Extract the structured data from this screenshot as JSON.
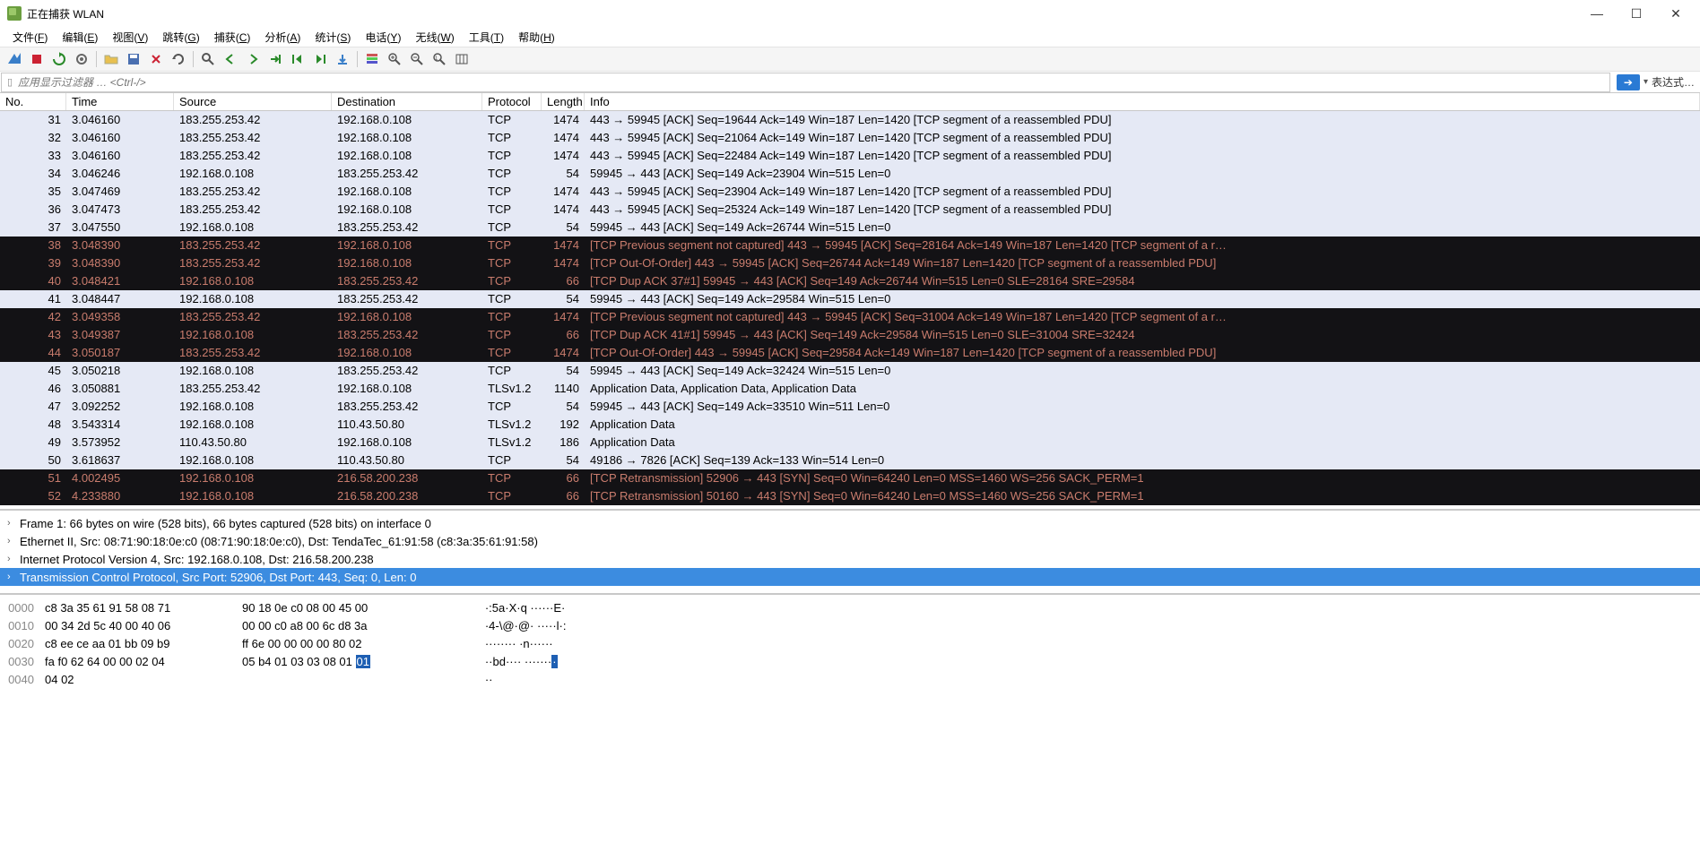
{
  "window": {
    "title": "正在捕获 WLAN"
  },
  "menu": {
    "items": [
      {
        "l": "文件",
        "u": "F"
      },
      {
        "l": "编辑",
        "u": "E"
      },
      {
        "l": "视图",
        "u": "V"
      },
      {
        "l": "跳转",
        "u": "G"
      },
      {
        "l": "捕获",
        "u": "C"
      },
      {
        "l": "分析",
        "u": "A"
      },
      {
        "l": "统计",
        "u": "S"
      },
      {
        "l": "电话",
        "u": "Y"
      },
      {
        "l": "无线",
        "u": "W"
      },
      {
        "l": "工具",
        "u": "T"
      },
      {
        "l": "帮助",
        "u": "H"
      }
    ]
  },
  "filter": {
    "placeholder": "应用显示过滤器 … <Ctrl-/>"
  },
  "expr": {
    "label": "表达式…"
  },
  "columns": {
    "no": "No.",
    "time": "Time",
    "source": "Source",
    "dest": "Destination",
    "proto": "Protocol",
    "len": "Length",
    "info": "Info"
  },
  "packets": [
    {
      "style": "light",
      "no": "31",
      "time": "3.046160",
      "src": "183.255.253.42",
      "dst": "192.168.0.108",
      "proto": "TCP",
      "len": "1474",
      "info": "443 → 59945 [ACK] Seq=19644 Ack=149 Win=187 Len=1420 [TCP segment of a reassembled PDU]"
    },
    {
      "style": "light",
      "no": "32",
      "time": "3.046160",
      "src": "183.255.253.42",
      "dst": "192.168.0.108",
      "proto": "TCP",
      "len": "1474",
      "info": "443 → 59945 [ACK] Seq=21064 Ack=149 Win=187 Len=1420 [TCP segment of a reassembled PDU]"
    },
    {
      "style": "light",
      "no": "33",
      "time": "3.046160",
      "src": "183.255.253.42",
      "dst": "192.168.0.108",
      "proto": "TCP",
      "len": "1474",
      "info": "443 → 59945 [ACK] Seq=22484 Ack=149 Win=187 Len=1420 [TCP segment of a reassembled PDU]"
    },
    {
      "style": "light",
      "no": "34",
      "time": "3.046246",
      "src": "192.168.0.108",
      "dst": "183.255.253.42",
      "proto": "TCP",
      "len": "54",
      "info": "59945 → 443 [ACK] Seq=149 Ack=23904 Win=515 Len=0"
    },
    {
      "style": "light",
      "no": "35",
      "time": "3.047469",
      "src": "183.255.253.42",
      "dst": "192.168.0.108",
      "proto": "TCP",
      "len": "1474",
      "info": "443 → 59945 [ACK] Seq=23904 Ack=149 Win=187 Len=1420 [TCP segment of a reassembled PDU]"
    },
    {
      "style": "light",
      "no": "36",
      "time": "3.047473",
      "src": "183.255.253.42",
      "dst": "192.168.0.108",
      "proto": "TCP",
      "len": "1474",
      "info": "443 → 59945 [ACK] Seq=25324 Ack=149 Win=187 Len=1420 [TCP segment of a reassembled PDU]"
    },
    {
      "style": "light",
      "no": "37",
      "time": "3.047550",
      "src": "192.168.0.108",
      "dst": "183.255.253.42",
      "proto": "TCP",
      "len": "54",
      "info": "59945 → 443 [ACK] Seq=149 Ack=26744 Win=515 Len=0"
    },
    {
      "style": "dark",
      "no": "38",
      "time": "3.048390",
      "src": "183.255.253.42",
      "dst": "192.168.0.108",
      "proto": "TCP",
      "len": "1474",
      "info": "[TCP Previous segment not captured] 443 → 59945 [ACK] Seq=28164 Ack=149 Win=187 Len=1420 [TCP segment of a r…"
    },
    {
      "style": "dark",
      "no": "39",
      "time": "3.048390",
      "src": "183.255.253.42",
      "dst": "192.168.0.108",
      "proto": "TCP",
      "len": "1474",
      "info": "[TCP Out-Of-Order] 443 → 59945 [ACK] Seq=26744 Ack=149 Win=187 Len=1420 [TCP segment of a reassembled PDU]"
    },
    {
      "style": "dark",
      "no": "40",
      "time": "3.048421",
      "src": "192.168.0.108",
      "dst": "183.255.253.42",
      "proto": "TCP",
      "len": "66",
      "info": "[TCP Dup ACK 37#1] 59945 → 443 [ACK] Seq=149 Ack=26744 Win=515 Len=0 SLE=28164 SRE=29584"
    },
    {
      "style": "light",
      "no": "41",
      "time": "3.048447",
      "src": "192.168.0.108",
      "dst": "183.255.253.42",
      "proto": "TCP",
      "len": "54",
      "info": "59945 → 443 [ACK] Seq=149 Ack=29584 Win=515 Len=0"
    },
    {
      "style": "dark",
      "no": "42",
      "time": "3.049358",
      "src": "183.255.253.42",
      "dst": "192.168.0.108",
      "proto": "TCP",
      "len": "1474",
      "info": "[TCP Previous segment not captured] 443 → 59945 [ACK] Seq=31004 Ack=149 Win=187 Len=1420 [TCP segment of a r…"
    },
    {
      "style": "dark",
      "no": "43",
      "time": "3.049387",
      "src": "192.168.0.108",
      "dst": "183.255.253.42",
      "proto": "TCP",
      "len": "66",
      "info": "[TCP Dup ACK 41#1] 59945 → 443 [ACK] Seq=149 Ack=29584 Win=515 Len=0 SLE=31004 SRE=32424"
    },
    {
      "style": "dark",
      "no": "44",
      "time": "3.050187",
      "src": "183.255.253.42",
      "dst": "192.168.0.108",
      "proto": "TCP",
      "len": "1474",
      "info": "[TCP Out-Of-Order] 443 → 59945 [ACK] Seq=29584 Ack=149 Win=187 Len=1420 [TCP segment of a reassembled PDU]"
    },
    {
      "style": "light",
      "no": "45",
      "time": "3.050218",
      "src": "192.168.0.108",
      "dst": "183.255.253.42",
      "proto": "TCP",
      "len": "54",
      "info": "59945 → 443 [ACK] Seq=149 Ack=32424 Win=515 Len=0"
    },
    {
      "style": "light",
      "no": "46",
      "time": "3.050881",
      "src": "183.255.253.42",
      "dst": "192.168.0.108",
      "proto": "TLSv1.2",
      "len": "1140",
      "info": "Application Data, Application Data, Application Data"
    },
    {
      "style": "light",
      "no": "47",
      "time": "3.092252",
      "src": "192.168.0.108",
      "dst": "183.255.253.42",
      "proto": "TCP",
      "len": "54",
      "info": "59945 → 443 [ACK] Seq=149 Ack=33510 Win=511 Len=0"
    },
    {
      "style": "light",
      "no": "48",
      "time": "3.543314",
      "src": "192.168.0.108",
      "dst": "110.43.50.80",
      "proto": "TLSv1.2",
      "len": "192",
      "info": "Application Data"
    },
    {
      "style": "light",
      "no": "49",
      "time": "3.573952",
      "src": "110.43.50.80",
      "dst": "192.168.0.108",
      "proto": "TLSv1.2",
      "len": "186",
      "info": "Application Data"
    },
    {
      "style": "light",
      "no": "50",
      "time": "3.618637",
      "src": "192.168.0.108",
      "dst": "110.43.50.80",
      "proto": "TCP",
      "len": "54",
      "info": "49186 → 7826 [ACK] Seq=139 Ack=133 Win=514 Len=0"
    },
    {
      "style": "dark",
      "no": "51",
      "time": "4.002495",
      "src": "192.168.0.108",
      "dst": "216.58.200.238",
      "proto": "TCP",
      "len": "66",
      "info": "[TCP Retransmission] 52906 → 443 [SYN] Seq=0 Win=64240 Len=0 MSS=1460 WS=256 SACK_PERM=1"
    },
    {
      "style": "dark",
      "no": "52",
      "time": "4.233880",
      "src": "192.168.0.108",
      "dst": "216.58.200.238",
      "proto": "TCP",
      "len": "66",
      "info": "[TCP Retransmission] 50160 → 443 [SYN] Seq=0 Win=64240 Len=0 MSS=1460 WS=256 SACK_PERM=1"
    }
  ],
  "details": [
    {
      "sel": false,
      "text": "Frame 1: 66 bytes on wire (528 bits), 66 bytes captured (528 bits) on interface 0"
    },
    {
      "sel": false,
      "text": "Ethernet II, Src: 08:71:90:18:0e:c0 (08:71:90:18:0e:c0), Dst: TendaTec_61:91:58 (c8:3a:35:61:91:58)"
    },
    {
      "sel": false,
      "text": "Internet Protocol Version 4, Src: 192.168.0.108, Dst: 216.58.200.238"
    },
    {
      "sel": true,
      "text": "Transmission Control Protocol, Src Port: 52906, Dst Port: 443, Seq: 0, Len: 0"
    }
  ],
  "hex": [
    {
      "off": "0000",
      "b1": "c8 3a 35 61 91 58 08 71",
      "b2": "90 18 0e c0 08 00 45 00",
      "asc": "   ·:5a·X·q ······E·"
    },
    {
      "off": "0010",
      "b1": "00 34 2d 5c 40 00 40 06",
      "b2": "00 00 c0 a8 00 6c d8 3a",
      "asc": "   ·4-\\@·@· ·····l·:"
    },
    {
      "off": "0020",
      "b1": "c8 ee ce aa 01 bb 09 b9",
      "b2": "ff 6e 00 00 00 00 80 02",
      "asc": "   ········ ·n······"
    },
    {
      "off": "0030",
      "b1": "fa f0 62 64 00 00 02 04",
      "b2": "05 b4 01 03 03 08 01 ",
      "asc": "   ··bd···· ·······",
      "hl": "01",
      "asc2": "·"
    },
    {
      "off": "0040",
      "b1": "04 02",
      "b2": "",
      "asc": "   ··"
    }
  ],
  "icons": {
    "shark": "app",
    "stop": "■",
    "restart": "↻",
    "capopt": "⚙",
    "open": "📂",
    "save": "💾",
    "close": "✖",
    "reload": "⟳",
    "find": "🔍",
    "back": "←",
    "fwd": "→",
    "goto": "↷",
    "first": "⇤",
    "last": "⇥",
    "auto": "⇩",
    "color": "▦",
    "plus": "+",
    "zoomin": "+",
    "zoomout": "−",
    "zoom1": "1:1",
    "resize": "⇔"
  }
}
